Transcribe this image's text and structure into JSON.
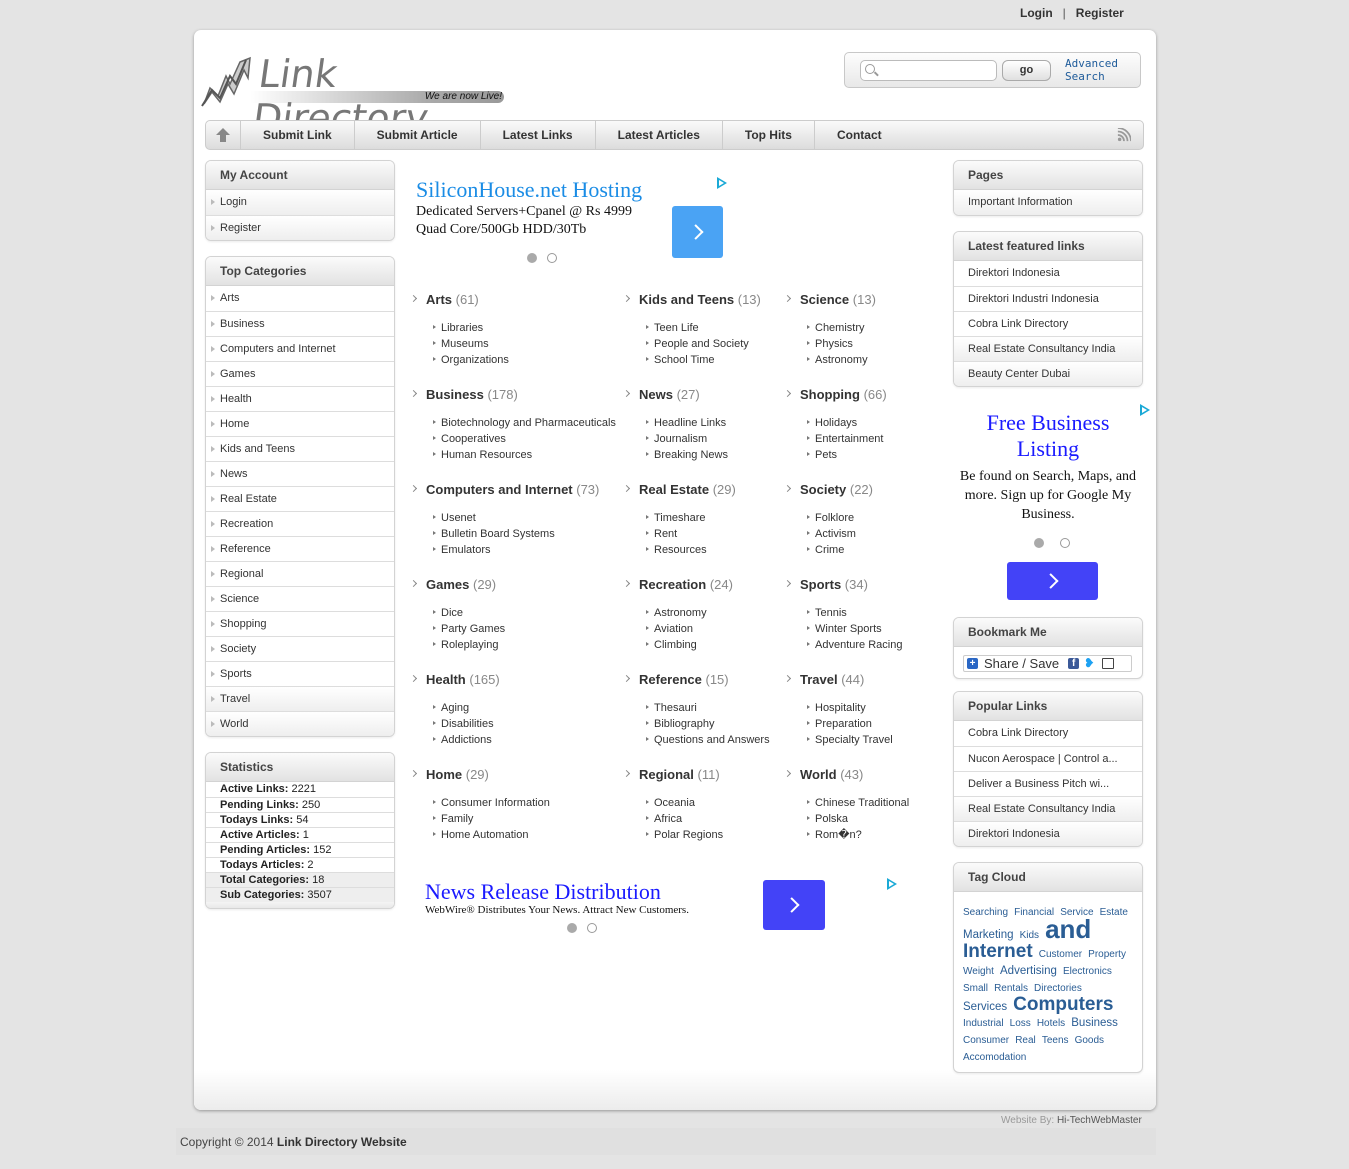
{
  "top_links": {
    "login": "Login",
    "separator": "|",
    "register": "Register"
  },
  "logo": {
    "title": "Link Directory",
    "tagline": "We are now Live!"
  },
  "search": {
    "placeholder": "",
    "value": "",
    "go_label": "go",
    "advanced_line1": "Advanced",
    "advanced_line2": "Search"
  },
  "nav": {
    "items": [
      "Submit Link",
      "Submit Article",
      "Latest Links",
      "Latest Articles",
      "Top Hits",
      "Contact"
    ]
  },
  "left": {
    "my_account": {
      "title": "My Account",
      "items": [
        "Login",
        "Register"
      ]
    },
    "top_categories": {
      "title": "Top Categories",
      "items": [
        "Arts",
        "Business",
        "Computers and Internet",
        "Games",
        "Health",
        "Home",
        "Kids and Teens",
        "News",
        "Real Estate",
        "Recreation",
        "Reference",
        "Regional",
        "Science",
        "Shopping",
        "Society",
        "Sports",
        "Travel",
        "World"
      ]
    },
    "statistics": {
      "title": "Statistics",
      "items": [
        {
          "label": "Active Links:",
          "value": "2221"
        },
        {
          "label": "Pending Links:",
          "value": "250"
        },
        {
          "label": "Todays Links:",
          "value": "54"
        },
        {
          "label": "Active Articles:",
          "value": "1"
        },
        {
          "label": "Pending Articles:",
          "value": "152"
        },
        {
          "label": "Todays Articles:",
          "value": "2"
        },
        {
          "label": "Total Categories:",
          "value": "18"
        },
        {
          "label": "Sub Categories:",
          "value": "3507"
        }
      ]
    }
  },
  "ads": {
    "top": {
      "title": "SiliconHouse.net Hosting",
      "line1": "Dedicated Servers+Cpanel @ Rs 4999",
      "line2": "Quad Core/500Gb HDD/30Tb",
      "color": "#4aa3f4"
    },
    "bottom": {
      "title": "News Release Distribution",
      "line1": "WebWire® Distributes Your News. Attract New Customers.",
      "color": "#4343f7"
    },
    "right": {
      "title": "Free Business Listing",
      "line1": "Be found on Search, Maps, and more. Sign up for Google My Business.",
      "color": "#4343f7"
    }
  },
  "categories": [
    {
      "name": "Arts",
      "count": "(61)",
      "subs": [
        "Libraries",
        "Museums",
        "Organizations"
      ]
    },
    {
      "name": "Kids and Teens",
      "count": "(13)",
      "subs": [
        "Teen Life",
        "People and Society",
        "School Time"
      ]
    },
    {
      "name": "Science",
      "count": "(13)",
      "subs": [
        "Chemistry",
        "Physics",
        "Astronomy"
      ]
    },
    {
      "name": "Business",
      "count": "(178)",
      "subs": [
        "Biotechnology and Pharmaceuticals",
        "Cooperatives",
        "Human Resources"
      ]
    },
    {
      "name": "News",
      "count": "(27)",
      "subs": [
        "Headline Links",
        "Journalism",
        "Breaking News"
      ]
    },
    {
      "name": "Shopping",
      "count": "(66)",
      "subs": [
        "Holidays",
        "Entertainment",
        "Pets"
      ]
    },
    {
      "name": "Computers and Internet",
      "count": "(73)",
      "subs": [
        "Usenet",
        "Bulletin Board Systems",
        "Emulators"
      ]
    },
    {
      "name": "Real Estate",
      "count": "(29)",
      "subs": [
        "Timeshare",
        "Rent",
        "Resources"
      ]
    },
    {
      "name": "Society",
      "count": "(22)",
      "subs": [
        "Folklore",
        "Activism",
        "Crime"
      ]
    },
    {
      "name": "Games",
      "count": "(29)",
      "subs": [
        "Dice",
        "Party Games",
        "Roleplaying"
      ]
    },
    {
      "name": "Recreation",
      "count": "(24)",
      "subs": [
        "Astronomy",
        "Aviation",
        "Climbing"
      ]
    },
    {
      "name": "Sports",
      "count": "(34)",
      "subs": [
        "Tennis",
        "Winter Sports",
        "Adventure Racing"
      ]
    },
    {
      "name": "Health",
      "count": "(165)",
      "subs": [
        "Aging",
        "Disabilities",
        "Addictions"
      ]
    },
    {
      "name": "Reference",
      "count": "(15)",
      "subs": [
        "Thesauri",
        "Bibliography",
        "Questions and Answers"
      ]
    },
    {
      "name": "Travel",
      "count": "(44)",
      "subs": [
        "Hospitality",
        "Preparation",
        "Specialty Travel"
      ]
    },
    {
      "name": "Home",
      "count": "(29)",
      "subs": [
        "Consumer Information",
        "Family",
        "Home Automation"
      ]
    },
    {
      "name": "Regional",
      "count": "(11)",
      "subs": [
        "Oceania",
        "Africa",
        "Polar Regions"
      ]
    },
    {
      "name": "World",
      "count": "(43)",
      "subs": [
        "Chinese Traditional",
        "Polska",
        "Rom�n?"
      ]
    }
  ],
  "right": {
    "pages": {
      "title": "Pages",
      "items": [
        "Important Information"
      ]
    },
    "featured": {
      "title": "Latest featured links",
      "items": [
        "Direktori Indonesia",
        "Direktori Industri Indonesia",
        "Cobra Link Directory",
        "Real Estate Consultancy India",
        "Beauty Center Dubai"
      ]
    },
    "bookmark": {
      "title": "Bookmark Me",
      "share_label": "Share / Save"
    },
    "popular": {
      "title": "Popular Links",
      "items": [
        "Cobra Link Directory",
        "Nucon Aerospace | Control a...",
        "Deliver a Business Pitch wi...",
        "Real Estate Consultancy India",
        "Direktori Indonesia"
      ]
    },
    "tagcloud": {
      "title": "Tag Cloud",
      "tags": [
        {
          "t": "Searching",
          "s": 1
        },
        {
          "t": "Financial",
          "s": 1
        },
        {
          "t": "Service",
          "s": 1
        },
        {
          "t": "Estate",
          "s": 1
        },
        {
          "t": "Marketing",
          "s": 2
        },
        {
          "t": "Kids",
          "s": 1
        },
        {
          "t": "and",
          "s": 5
        },
        {
          "t": "Internet",
          "s": 4
        },
        {
          "t": "Customer",
          "s": 1
        },
        {
          "t": "Property",
          "s": 1
        },
        {
          "t": "Weight",
          "s": 1
        },
        {
          "t": "Advertising",
          "s": 2
        },
        {
          "t": "Electronics",
          "s": 1
        },
        {
          "t": "Small",
          "s": 1
        },
        {
          "t": "Rentals",
          "s": 1
        },
        {
          "t": "Directories",
          "s": 1
        },
        {
          "t": "Services",
          "s": 2
        },
        {
          "t": "Computers",
          "s": 4
        },
        {
          "t": "Industrial",
          "s": 1
        },
        {
          "t": "Loss",
          "s": 1
        },
        {
          "t": "Hotels",
          "s": 1
        },
        {
          "t": "Business",
          "s": 2
        },
        {
          "t": "Consumer",
          "s": 1
        },
        {
          "t": "Real",
          "s": 1
        },
        {
          "t": "Teens",
          "s": 1
        },
        {
          "t": "Goods",
          "s": 1
        },
        {
          "t": "Accomodation",
          "s": 1
        }
      ],
      "color": "#2a5d94"
    }
  },
  "footer": {
    "by_label": "Website By:",
    "by_name": "Hi-TechWebMaster",
    "copyright": "Copyright © 2014",
    "site_name": "Link Directory Website"
  }
}
